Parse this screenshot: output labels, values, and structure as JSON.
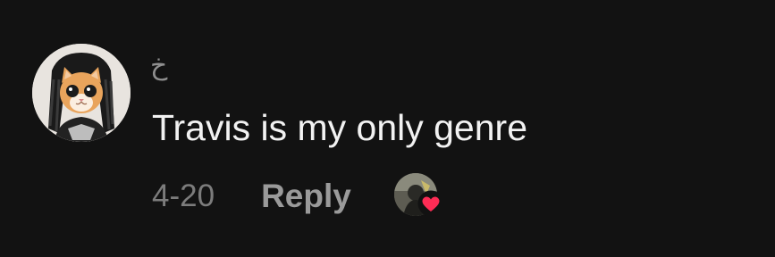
{
  "comment": {
    "username": "خ",
    "text": "Travis is my only genre",
    "date": "4-20",
    "reply_label": "Reply"
  },
  "icons": {
    "avatar": "cat-avatar",
    "liker": "creator-avatar",
    "like": "heart-icon"
  },
  "colors": {
    "background": "#121212",
    "text": "#f2f2f2",
    "muted": "#7c7c7c",
    "heart": "#fe2c55"
  }
}
